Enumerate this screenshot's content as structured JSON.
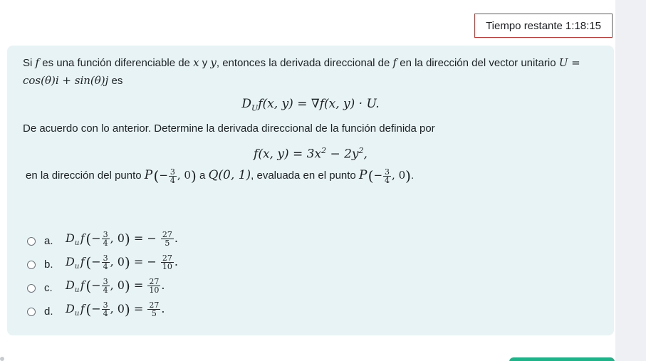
{
  "timer": {
    "label": "Tiempo restante",
    "value": "1:18:15"
  },
  "question": {
    "intro_1": "Si ",
    "f": "f",
    "intro_2": " es una función diferenciable de ",
    "x": "x",
    "y_conj": " y ",
    "y": "y",
    "intro_3": ", entonces la derivada direccional de ",
    "intro_4": " en la dirección del vector unitario ",
    "unit_vector": "U = cos(θ)i + sin(θ)j",
    "intro_5": " es",
    "formula_directional": "D",
    "formula_sub": "U",
    "formula_rest": "f(x, y) = ∇f(x, y) · U.",
    "instruction": "De acuerdo con lo anterior. Determine la derivada direccional de la función definida por",
    "function_lhs": "f(x, y) = 3x",
    "function_mid": " − 2y",
    "function_end": ",",
    "exp2": "2",
    "direction_1": "en la dirección del punto ",
    "point_P": "P",
    "direction_2": " a ",
    "point_Q": "Q(0, 1)",
    "direction_3": ", evaluada en el punto ",
    "frac_num": "3",
    "frac_den": "4"
  },
  "options": [
    {
      "letter": "a.",
      "sign": "= −",
      "num": "27",
      "den": "5"
    },
    {
      "letter": "b.",
      "sign": "= −",
      "num": "27",
      "den": "10"
    },
    {
      "letter": "c.",
      "sign": "=",
      "num": "27",
      "den": "10"
    },
    {
      "letter": "d.",
      "sign": "=",
      "num": "27",
      "den": "5"
    }
  ],
  "options_prefix": {
    "D": "D",
    "sub": "u",
    "f": "f"
  },
  "colors": {
    "question_bg": "#e7f3f5",
    "timer_border": "#c9302c",
    "next_button": "#1fb38a"
  }
}
